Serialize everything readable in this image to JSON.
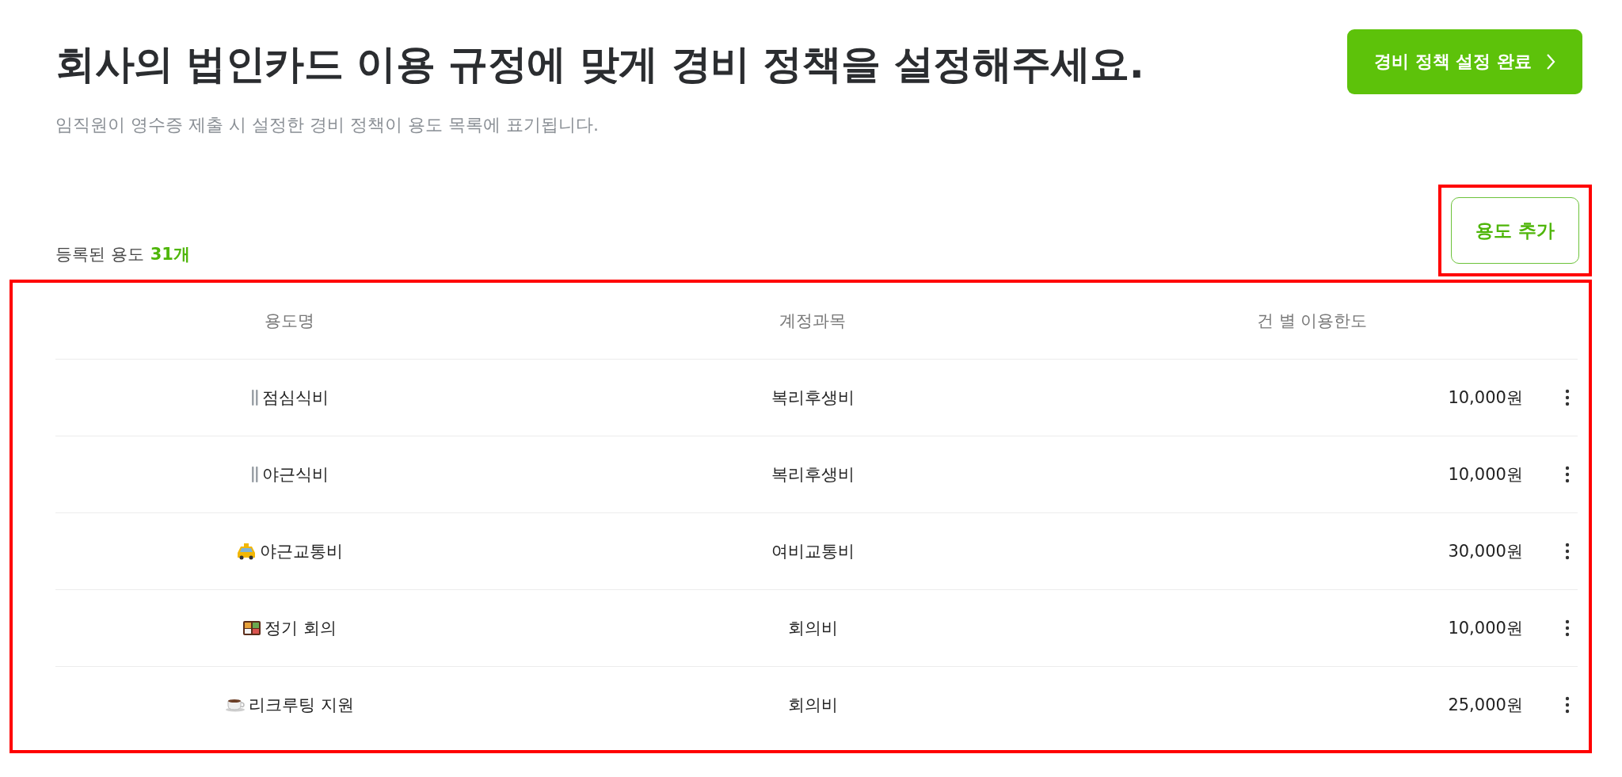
{
  "header": {
    "title": "회사의 법인카드 이용 규정에 맞게 경비 정책을 설정해주세요.",
    "subtitle": "임직원이 영수증 제출 시 설정한 경비 정책이 용도 목록에 표기됩니다.",
    "complete_button": "경비 정책 설정 완료"
  },
  "summary": {
    "label": "등록된 용도",
    "count": "31개"
  },
  "add_button": {
    "label": "용도 추가",
    "highlighted": true
  },
  "table": {
    "highlighted": true,
    "columns": [
      "용도명",
      "계정과목",
      "건 별 이용한도"
    ],
    "rows": [
      {
        "kind": "meal",
        "name": "점심식비",
        "account": "복리후생비",
        "limit": "10,000원"
      },
      {
        "kind": "meal",
        "name": "야근식비",
        "account": "복리후생비",
        "limit": "10,000원"
      },
      {
        "kind": "transport",
        "name": "야근교통비",
        "account": "여비교통비",
        "limit": "30,000원"
      },
      {
        "kind": "meeting",
        "name": "정기 회의",
        "account": "회의비",
        "limit": "10,000원"
      },
      {
        "kind": "recruiting",
        "name": "리크루팅 지원",
        "account": "회의비",
        "limit": "25,000원"
      }
    ]
  }
}
